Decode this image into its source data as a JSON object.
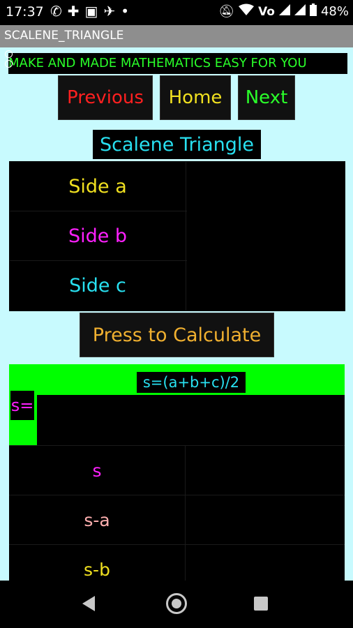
{
  "status_bar": {
    "time": "17:37",
    "app_icons": [
      "whatsapp-icon",
      "wheel-icon",
      "facebook-icon",
      "twitter-icon",
      "dot-icon"
    ],
    "battery": "48%"
  },
  "app": {
    "title": "SCALENE_TRIANGLE",
    "marquee": "MAKE AND MADE MATHEMATICS EASY FOR YOU"
  },
  "nav_buttons": {
    "previous": "Previous",
    "home": "Home",
    "next": "Next"
  },
  "subtitle": "Scalene Triangle",
  "inputs": [
    {
      "label": "Side a",
      "value": "",
      "color": "#f0e020"
    },
    {
      "label": "Side b",
      "value": "",
      "color": "#ff20ff"
    },
    {
      "label": "Side c",
      "value": "",
      "color": "#28e0f0"
    }
  ],
  "calculate_label": "Press to Calculate",
  "formula": "s=(a+b+c)/2",
  "s_label": "s=",
  "outputs": [
    {
      "label": "s",
      "color": "#ff20ff"
    },
    {
      "label": "s-a",
      "color": "#ffb0b0"
    },
    {
      "label": "s-b",
      "color": "#f0e020"
    }
  ],
  "colors": {
    "background": "#c8fafe",
    "accent_green": "#00ff00",
    "previous": "#ff2020",
    "home": "#f0e020",
    "next": "#2aff2a"
  }
}
